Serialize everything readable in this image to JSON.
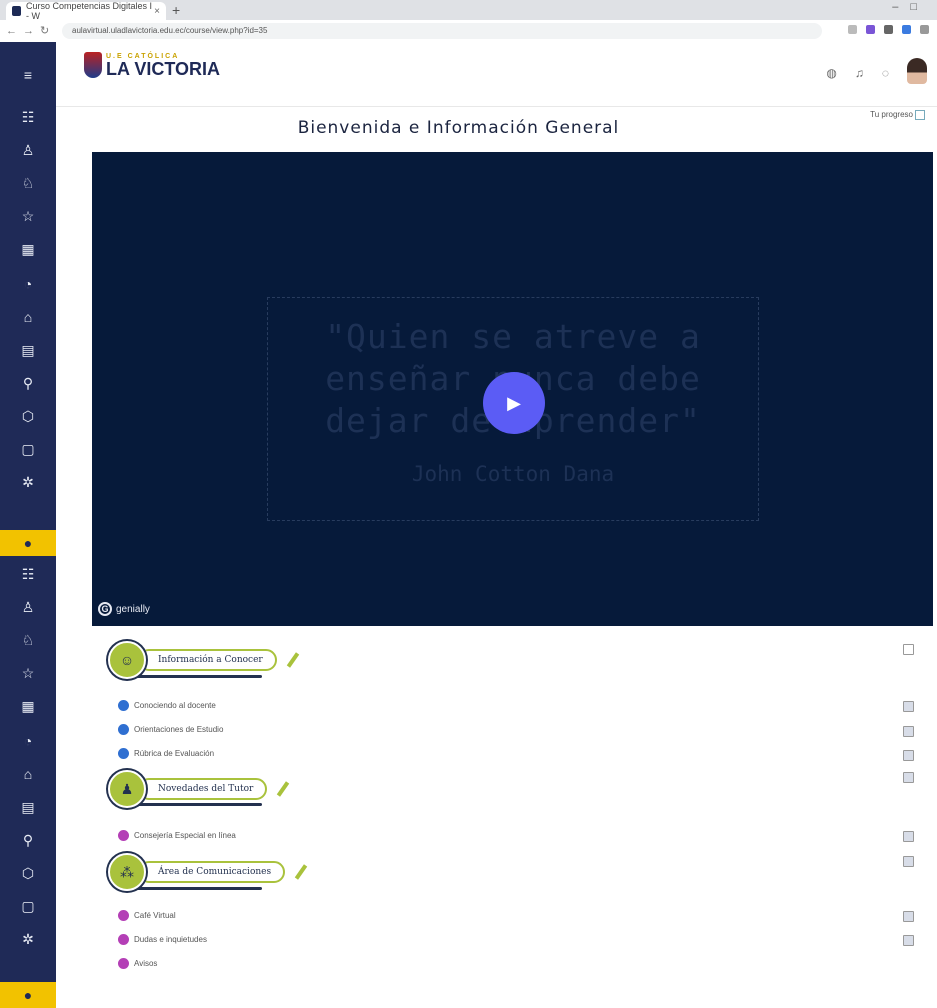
{
  "browser": {
    "tab_title": "Curso Competencias Digitales I - W",
    "new_tab": "+",
    "url": "aulavirtual.uladlavictoria.edu.ec/course/view.php?id=35"
  },
  "sidebar": {
    "top_icons": [
      "≡",
      "☷",
      "♙",
      "♘",
      "☆",
      "▦",
      "◔",
      "⌂",
      "▤",
      "⚲",
      "⬡",
      "▢",
      "✲"
    ],
    "active_index": 13,
    "bottom_icons": [
      "≡",
      "☷",
      "♙",
      "♘",
      "☆",
      "▦",
      "◔",
      "⌂",
      "▤",
      "⚲",
      "⬡",
      "▢",
      "✲"
    ]
  },
  "header": {
    "logo_top": "U.E CATÓLICA",
    "logo_main": "LA VICTORIA",
    "icons": [
      "globe-icon",
      "bell-icon",
      "chat-icon"
    ]
  },
  "page": {
    "progress_label": "Tu progreso",
    "title": "Bienvenida e Información General"
  },
  "video": {
    "quote_line1": "\"Quien se atreve a",
    "quote_line2": "enseñar nunca debe",
    "quote_line3": "dejar de aprender\"",
    "author": "John Cotton Dana",
    "brand": "genially"
  },
  "sections": [
    {
      "label": "Información a Conocer",
      "items": [
        "Conociendo al docente",
        "Orientaciones de Estudio",
        "Rúbrica de Evaluación"
      ]
    },
    {
      "label": "Novedades del Tutor",
      "items": [
        "Consejería Especial en línea"
      ]
    },
    {
      "label": "Área de Comunicaciones",
      "items": [
        "Café Virtual",
        "Dudas e inquietudes",
        "Avisos"
      ]
    }
  ],
  "colors": {
    "sidebar": "#1f2a57",
    "accent": "#f2c200",
    "video_bg": "#061a3a",
    "play": "#5b5cf5",
    "section_green": "#a9c23c"
  }
}
